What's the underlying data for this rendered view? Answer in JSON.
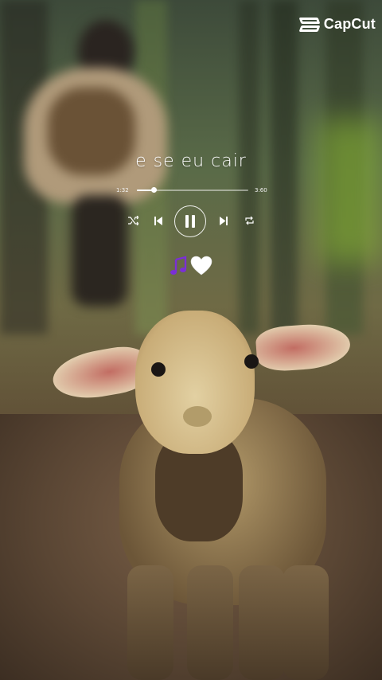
{
  "watermark": {
    "brand": "CapCut",
    "icon": "capcut-logo-icon"
  },
  "player": {
    "song_title": "e se eu cair",
    "current_time": "1:32",
    "total_time": "3:60",
    "progress": 0.15,
    "controls": {
      "shuffle": "shuffle-icon",
      "previous": "previous-icon",
      "play_pause": "pause-icon",
      "next": "next-icon",
      "repeat": "repeat-icon"
    }
  },
  "decorations": {
    "emojis": [
      "music-notes-icon",
      "white-heart-icon"
    ],
    "note_color": "#7b2fd6",
    "heart_color": "#ffffff"
  },
  "background": {
    "description_icon": "lamb-photo"
  }
}
